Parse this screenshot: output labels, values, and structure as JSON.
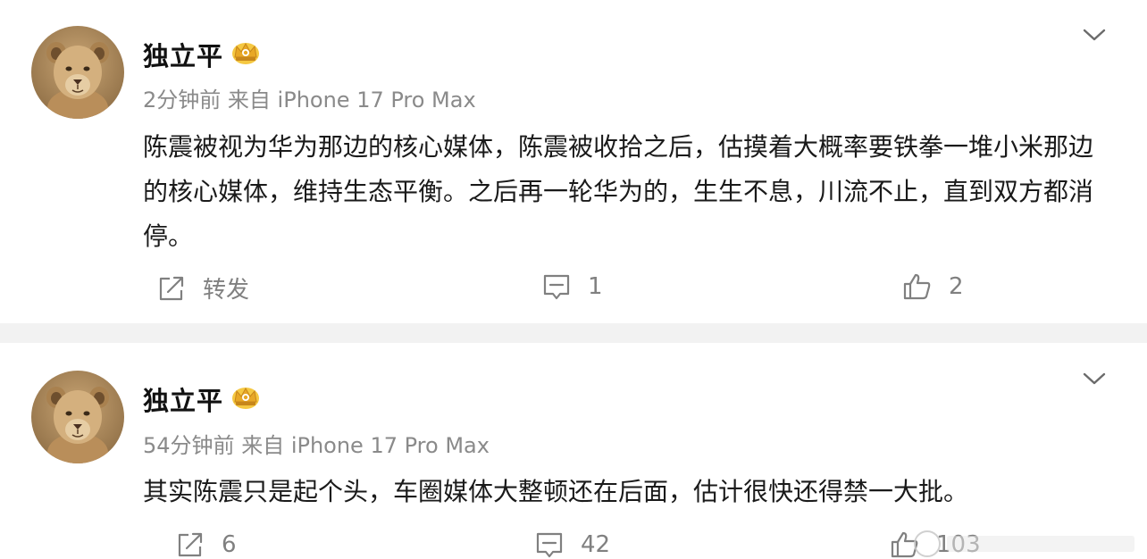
{
  "posts": [
    {
      "user_name": "独立平",
      "time": "2分钟前",
      "source": "来自 iPhone 17 Pro Max",
      "text": "陈震被视为华为那边的核心媒体，陈震被收拾之后，估摸着大概率要铁拳一堆小米那边的核心媒体，维持生态平衡。之后再一轮华为的，生生不息，川流不止，直到双方都消停。",
      "repost_label": "转发",
      "comment_count": "1",
      "like_count": "2"
    },
    {
      "user_name": "独立平",
      "time": "54分钟前",
      "source": "来自 iPhone 17 Pro Max",
      "text": "其实陈震只是起个头，车圈媒体大整顿还在后面，估计很快还得禁一大批。",
      "repost_label": "6",
      "comment_count": "42",
      "like_count": "103"
    }
  ],
  "icons": {
    "avatar": "lion-cub-avatar",
    "badge": "crown-badge-icon",
    "menu": "chevron-down-icon",
    "repost": "repost-icon",
    "comment": "comment-icon",
    "like": "thumbs-up-icon"
  },
  "colors": {
    "name": "#111111",
    "meta": "#8a8a8a",
    "text": "#1a1a1a",
    "action": "#808080",
    "badge_gold": "#e8a826",
    "separator": "#f2f2f2"
  }
}
